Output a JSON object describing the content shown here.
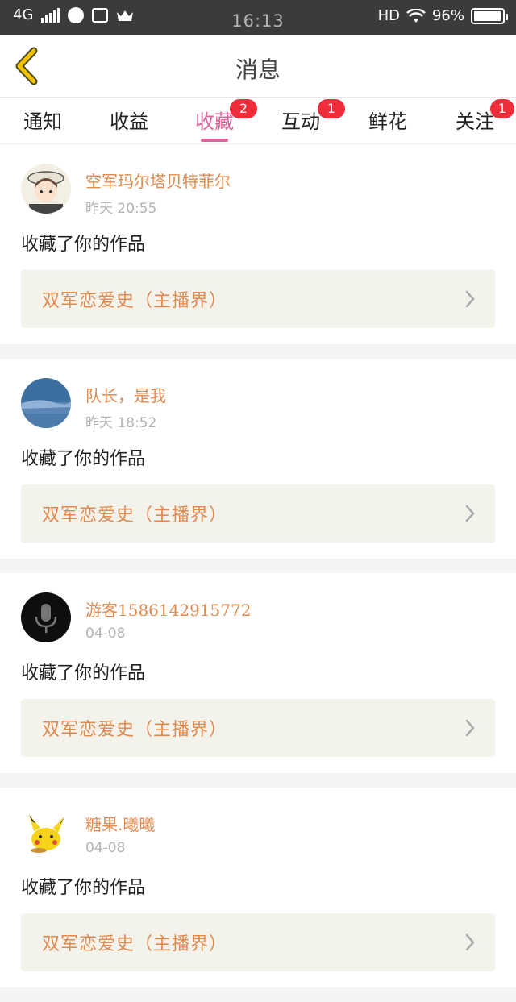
{
  "status_bar": {
    "network": "4G",
    "time": "16:13",
    "hd": "HD",
    "battery_text": "96%",
    "battery_level": 0.96
  },
  "header": {
    "title": "消息",
    "back_icon": "chevron-left-icon",
    "accent_color": "#f2c200"
  },
  "tabs": [
    {
      "label": "通知",
      "badge": ""
    },
    {
      "label": "收益",
      "badge": ""
    },
    {
      "label": "收藏",
      "badge": "2",
      "active": true
    },
    {
      "label": "互动",
      "badge": "1"
    },
    {
      "label": "鲜花",
      "badge": ""
    },
    {
      "label": "关注",
      "badge": "1"
    }
  ],
  "colors": {
    "active_tab": "#e0609a",
    "badge": "#ee2c3a",
    "username": "#e28a4e",
    "work_bg": "#f3f3ec"
  },
  "items": [
    {
      "username": "空军玛尔塔贝特菲尔",
      "time": "昨天 20:55",
      "action": "收藏了你的作品",
      "work": "双军恋爱史（主播界）",
      "avatar": "anime-avatar"
    },
    {
      "username": "队长，是我",
      "time": "昨天 18:52",
      "action": "收藏了你的作品",
      "work": "双军恋爱史（主播界）",
      "avatar": "landscape-avatar"
    },
    {
      "username": "游客1586142915772",
      "time": "04-08",
      "action": "收藏了你的作品",
      "work": "双军恋爱史（主播界）",
      "avatar": "microphone-avatar"
    },
    {
      "username": "糖果.曦曦",
      "time": "04-08",
      "action": "收藏了你的作品",
      "work": "双军恋爱史（主播界）",
      "avatar": "pikachu-avatar"
    }
  ]
}
